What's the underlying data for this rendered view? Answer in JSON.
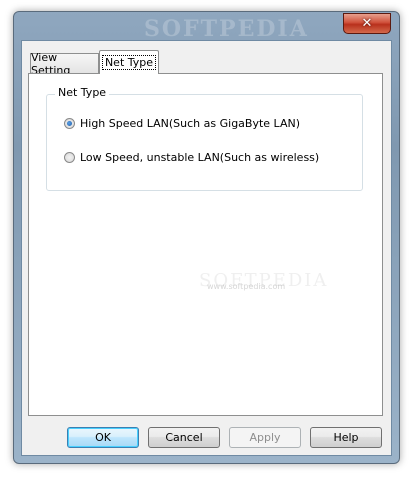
{
  "watermark": "SOFTPEDIA",
  "titlebar": {
    "close_glyph": "✕"
  },
  "tabs": [
    {
      "label": "View Setting",
      "active": false
    },
    {
      "label": "Net Type",
      "active": true
    }
  ],
  "group": {
    "title": "Net Type",
    "options": [
      {
        "label": "High Speed LAN(Such as GigaByte LAN)",
        "selected": true
      },
      {
        "label": "Low Speed, unstable LAN(Such as wireless)",
        "selected": false
      }
    ]
  },
  "panel_watermark": {
    "big": "SOFTPEDIA",
    "small": "www.softpedia.com"
  },
  "buttons": {
    "ok": "OK",
    "cancel": "Cancel",
    "apply": "Apply",
    "help": "Help"
  },
  "icons": {
    "close": "close-icon",
    "radio": "radio-button-icon"
  },
  "colors": {
    "accent": "#3c7fb1",
    "close": "#c8412b",
    "frame": "#8fa7bf"
  }
}
